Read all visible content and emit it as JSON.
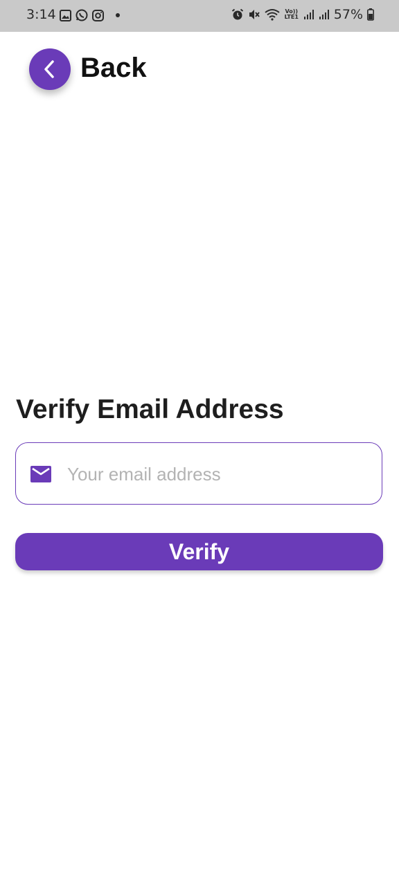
{
  "status_bar": {
    "time": "3:14",
    "battery_percent": "57%",
    "lte_label": "Vo)) LTE1",
    "left_icons": [
      "gallery-icon",
      "whatsapp-icon",
      "instagram-icon",
      "dot-icon"
    ],
    "right_icons": [
      "alarm-icon",
      "mute-icon",
      "wifi-icon",
      "lte-icon",
      "signal-icon",
      "signal-icon",
      "battery-icon"
    ]
  },
  "header": {
    "back_label": "Back",
    "back_icon": "chevron-left-icon"
  },
  "form": {
    "title": "Verify Email Address",
    "email_placeholder": "Your email address",
    "email_value": "",
    "email_icon": "mail-icon"
  },
  "actions": {
    "verify_label": "Verify"
  },
  "colors": {
    "accent": "#6a3bb8",
    "status_bar_bg": "#c9c9c9",
    "placeholder": "#b3b3b3",
    "text_dark": "#1e1e1e"
  }
}
